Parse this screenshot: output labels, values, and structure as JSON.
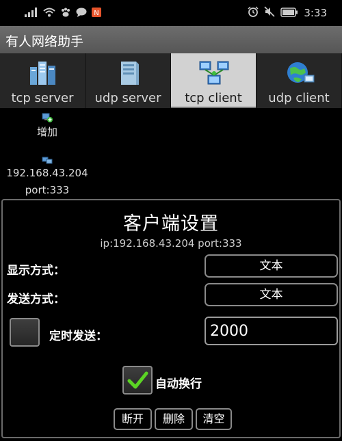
{
  "status_bar": {
    "time": "3:33",
    "left_icons": [
      "signal-icon",
      "wifi-icon",
      "paw-icon",
      "chat-icon",
      "notification-icon"
    ],
    "right_icons": [
      "alarm-icon",
      "mute-icon",
      "battery-icon"
    ]
  },
  "app": {
    "title": "有人网络助手"
  },
  "tabs": [
    {
      "label": "tcp server",
      "icon": "server-icon",
      "active": false
    },
    {
      "label": "udp server",
      "icon": "server-tower-icon",
      "active": false
    },
    {
      "label": "tcp client",
      "icon": "network-client-icon",
      "active": true
    },
    {
      "label": "udp client",
      "icon": "globe-network-icon",
      "active": false
    }
  ],
  "connections": {
    "add_label": "增加",
    "items": [
      {
        "ip": "192.168.43.204",
        "port": "port:333"
      }
    ]
  },
  "dialog": {
    "title": "客户端设置",
    "subtitle": "ip:192.168.43.204  port:333",
    "display_mode": {
      "label": "显示方式：",
      "value": "文本"
    },
    "send_mode": {
      "label": "发送方式：",
      "value": "文本"
    },
    "timed_send": {
      "label": "定时发送：",
      "checked": false,
      "interval": "2000"
    },
    "auto_newline": {
      "label": "自动换行",
      "checked": true
    },
    "buttons": {
      "disconnect": "断开",
      "delete": "删除",
      "clear": "清空"
    }
  },
  "colors": {
    "active_tab": "#d2d2d2",
    "titlebar": "#5e5e5e",
    "check_green": "#5bd424"
  }
}
